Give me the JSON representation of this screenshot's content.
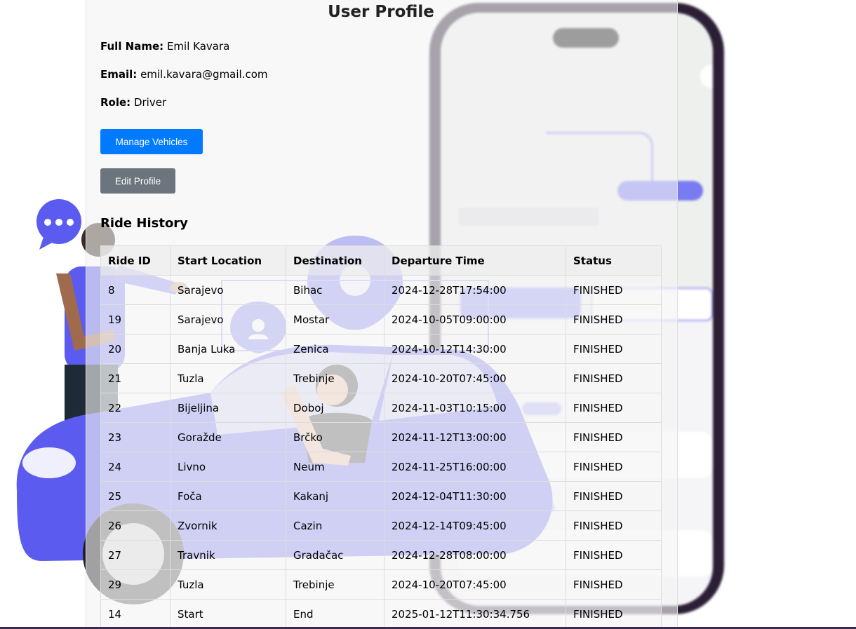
{
  "page": {
    "title": "User Profile"
  },
  "profile": {
    "full_name_label": "Full Name:",
    "full_name": "Emil Kavara",
    "email_label": "Email:",
    "email": "emil.kavara@gmail.com",
    "role_label": "Role:",
    "role": "Driver"
  },
  "actions": {
    "manage_vehicles": "Manage Vehicles",
    "edit_profile": "Edit Profile"
  },
  "ride_history": {
    "heading": "Ride History",
    "columns": [
      "Ride ID",
      "Start Location",
      "Destination",
      "Departure Time",
      "Status"
    ],
    "rows": [
      [
        "8",
        "Sarajevo",
        "Bihac",
        "2024-12-28T17:54:00",
        "FINISHED"
      ],
      [
        "19",
        "Sarajevo",
        "Mostar",
        "2024-10-05T09:00:00",
        "FINISHED"
      ],
      [
        "20",
        "Banja Luka",
        "Zenica",
        "2024-10-12T14:30:00",
        "FINISHED"
      ],
      [
        "21",
        "Tuzla",
        "Trebinje",
        "2024-10-20T07:45:00",
        "FINISHED"
      ],
      [
        "22",
        "Bijeljina",
        "Doboj",
        "2024-11-03T10:15:00",
        "FINISHED"
      ],
      [
        "23",
        "Goražde",
        "Brčko",
        "2024-11-12T13:00:00",
        "FINISHED"
      ],
      [
        "24",
        "Livno",
        "Neum",
        "2024-11-25T16:00:00",
        "FINISHED"
      ],
      [
        "25",
        "Foča",
        "Kakanj",
        "2024-12-04T11:30:00",
        "FINISHED"
      ],
      [
        "26",
        "Zvornik",
        "Cazin",
        "2024-12-14T09:45:00",
        "FINISHED"
      ],
      [
        "27",
        "Travnik",
        "Gradačac",
        "2024-12-28T08:00:00",
        "FINISHED"
      ],
      [
        "29",
        "Tuzla",
        "Trebinje",
        "2024-10-20T07:45:00",
        "FINISHED"
      ],
      [
        "14",
        "Start",
        "End",
        "2025-01-12T11:30:34.756",
        "FINISHED"
      ]
    ]
  },
  "background": {
    "icons": [
      "chat-bubble-icon",
      "location-pin-icon",
      "user-location-icon"
    ],
    "colors": {
      "accent": "#5b5cef",
      "primary_button": "#007bff",
      "secondary_button": "#6c757d",
      "phone_frame": "#2c1f35"
    }
  }
}
